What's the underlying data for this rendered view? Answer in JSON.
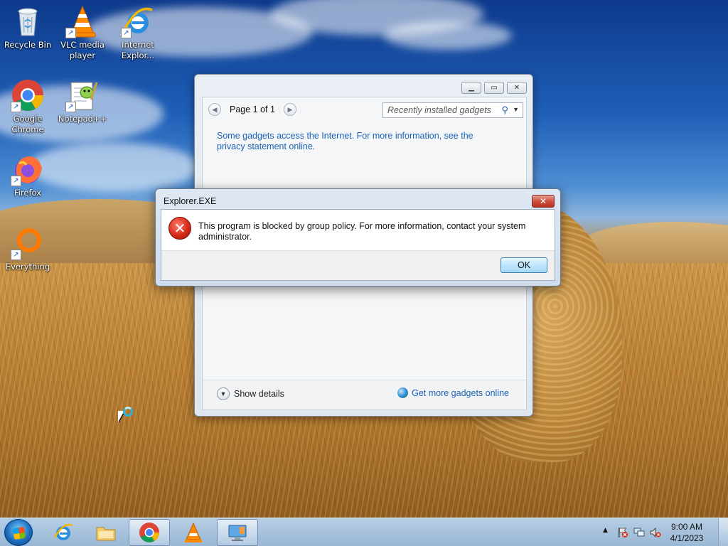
{
  "desktop": {
    "icons": [
      {
        "label": "Recycle Bin",
        "icon": "recycle-bin-icon"
      },
      {
        "label": "VLC media player",
        "icon": "vlc-icon"
      },
      {
        "label": "Internet Explor...",
        "icon": "internet-explorer-icon"
      },
      {
        "label": "Google Chrome",
        "icon": "chrome-icon"
      },
      {
        "label": "Notepad++",
        "icon": "notepad-plus-plus-icon"
      },
      {
        "label": "Firefox",
        "icon": "firefox-icon"
      },
      {
        "label": "Everything",
        "icon": "everything-search-icon"
      }
    ]
  },
  "gadget_window": {
    "pager": {
      "label": "Page 1 of 1",
      "prev_icon": "arrow-left-icon",
      "next_icon": "arrow-right-icon"
    },
    "search": {
      "value": "Recently installed gadgets",
      "icon": "search-icon"
    },
    "info_text": "Some gadgets access the Internet.  For more information, see the privacy statement online.",
    "show_details": "Show details",
    "get_more": "Get more gadgets online"
  },
  "dialog": {
    "title": "Explorer.EXE",
    "message": "This program is blocked by group policy. For more information, contact your system administrator.",
    "ok_label": "OK",
    "close_glyph": "✕",
    "icon": "error-icon"
  },
  "taskbar": {
    "pinned": [
      {
        "name": "internet-explorer",
        "icon": "internet-explorer-icon",
        "active": false
      },
      {
        "name": "file-explorer",
        "icon": "folder-icon",
        "active": false
      },
      {
        "name": "google-chrome",
        "icon": "chrome-icon",
        "active": true
      },
      {
        "name": "vlc",
        "icon": "vlc-icon",
        "active": false
      },
      {
        "name": "desktop-gadgets",
        "icon": "gadgets-icon",
        "active": true
      }
    ],
    "tray": {
      "time": "9:00 AM",
      "date": "4/1/2023",
      "icons": [
        "flag-icon",
        "network-icon",
        "volume-muted-icon"
      ]
    }
  },
  "colors": {
    "link_blue": "#1b64b8",
    "error_red": "#d62a17",
    "taskbar_blue": "#a9c3dd"
  }
}
